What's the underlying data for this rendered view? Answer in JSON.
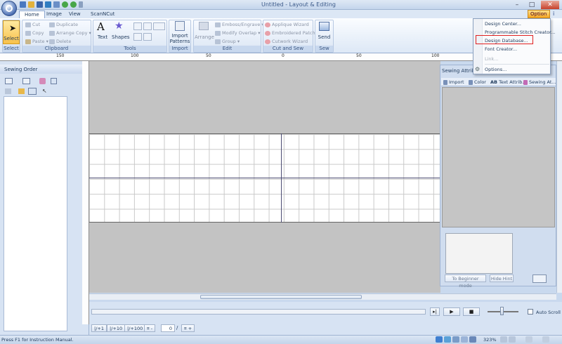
{
  "window": {
    "title": "Untitled - Layout & Editing",
    "min": "–",
    "max": "□",
    "close": "✕"
  },
  "tabs": [
    "Home",
    "Image",
    "View",
    "ScanNCut"
  ],
  "options_button": "Option",
  "options_arrow": "▾",
  "help_icon": "i",
  "ribbon": {
    "select": {
      "label": "Select",
      "group": "Select"
    },
    "clipboard": {
      "group": "Clipboard",
      "cut": "Cut",
      "copy": "Copy",
      "paste": "Paste",
      "duplicate": "Duplicate",
      "arrange_copy": "Arrange Copy",
      "delete": "Delete"
    },
    "tools": {
      "group": "Tools",
      "text": "Text",
      "shapes": "Shapes"
    },
    "import": {
      "group": "Import",
      "import_patterns": "Import",
      "import_patterns_2": "Patterns"
    },
    "edit": {
      "group": "Edit",
      "arrange": "Arrange",
      "emboss": "Emboss/Engrave",
      "modify_overlap": "Modify Overlap",
      "group_btn": "Group"
    },
    "cut_sew": {
      "group": "Cut and Sew",
      "applique": "Applique Wizard",
      "embroidered_patch": "Embroidered Patch",
      "cutwork": "Cutwork Wizard"
    },
    "sew": {
      "group": "Sew",
      "send": "Send"
    }
  },
  "options_menu": [
    {
      "label": "Design Center...",
      "enabled": true
    },
    {
      "label": "Programmable Stitch Creator...",
      "enabled": true
    },
    {
      "label": "Design Database...",
      "enabled": true,
      "highlighted": true
    },
    {
      "label": "Font Creator...",
      "enabled": true
    },
    {
      "label": "Link...",
      "enabled": false
    },
    {
      "label": "Options...",
      "enabled": true
    }
  ],
  "ruler": {
    "labels": [
      "150",
      "100",
      "50",
      "0",
      "50",
      "100"
    ]
  },
  "sewing_order": {
    "title": "Sewing Order",
    "close": "✕"
  },
  "sewing_attributes": {
    "title": "Sewing Attribu",
    "tabs": [
      "Import",
      "Color",
      "Text Attrib...",
      "Sewing At..."
    ],
    "beginner_button": "To Beginner mode",
    "hide_hint_button": "Hide Hint"
  },
  "playback": {
    "auto_scroll": "Auto Scroll"
  },
  "bottom_tools": {
    "t1": "+1",
    "t10": "+10",
    "t100": "+100",
    "minus": "-",
    "counter": "0",
    "slash": "/",
    "plus": "+"
  },
  "status": {
    "text": "Press  F1  for Instruction Manual.",
    "zoom": "323%"
  },
  "colors": {
    "accent": "#f5a623",
    "highlight_box": "#e02020",
    "page_grid": "#c9c9c9",
    "canvas_bg": "#c3c3c3"
  }
}
